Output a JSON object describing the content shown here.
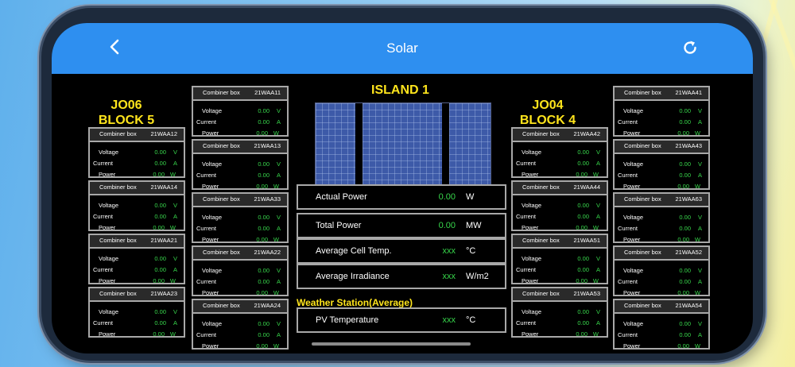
{
  "nav": {
    "title": "Solar",
    "back_icon": "chevron-left-icon",
    "refresh_icon": "refresh-icon"
  },
  "left_block": {
    "line1": "JO06",
    "line2": "BLOCK 5"
  },
  "right_block": {
    "line1": "JO04",
    "line2": "BLOCK 4"
  },
  "labels": {
    "header": "Combiner box",
    "voltage": "Voltage",
    "current": "Current",
    "power": "Power"
  },
  "combiner_columns": [
    {
      "boxes": [
        {
          "id": "21WAA12",
          "voltage": "0.00",
          "v_unit": "V",
          "current": "0.00",
          "c_unit": "A",
          "power": "0.00",
          "p_unit": "W"
        },
        {
          "id": "21WAA14",
          "voltage": "0.00",
          "v_unit": "V",
          "current": "0.00",
          "c_unit": "A",
          "power": "0.00",
          "p_unit": "W"
        },
        {
          "id": "21WAA21",
          "voltage": "0.00",
          "v_unit": "V",
          "current": "0.00",
          "c_unit": "A",
          "power": "0.00",
          "p_unit": "W"
        },
        {
          "id": "21WAA23",
          "voltage": "0.00",
          "v_unit": "V",
          "current": "0.00",
          "c_unit": "A",
          "power": "0.00",
          "p_unit": "W"
        }
      ]
    },
    {
      "boxes": [
        {
          "id": "21WAA11",
          "voltage": "0.00",
          "v_unit": "V",
          "current": "0.00",
          "c_unit": "A",
          "power": "0.00",
          "p_unit": "W"
        },
        {
          "id": "21WAA13",
          "voltage": "0.00",
          "v_unit": "V",
          "current": "0.00",
          "c_unit": "A",
          "power": "0.00",
          "p_unit": "W"
        },
        {
          "id": "21WAA33",
          "voltage": "0.00",
          "v_unit": "V",
          "current": "0.00",
          "c_unit": "A",
          "power": "0.00",
          "p_unit": "W"
        },
        {
          "id": "21WAA22",
          "voltage": "0.00",
          "v_unit": "V",
          "current": "0.00",
          "c_unit": "A",
          "power": "0.00",
          "p_unit": "W"
        },
        {
          "id": "21WAA24",
          "voltage": "0.00",
          "v_unit": "V",
          "current": "0.00",
          "c_unit": "A",
          "power": "0.00",
          "p_unit": "W"
        }
      ]
    },
    {
      "boxes": [
        {
          "id": "21WAA42",
          "voltage": "0.00",
          "v_unit": "V",
          "current": "0.00",
          "c_unit": "A",
          "power": "0.00",
          "p_unit": "W"
        },
        {
          "id": "21WAA44",
          "voltage": "0.00",
          "v_unit": "V",
          "current": "0.00",
          "c_unit": "A",
          "power": "0.00",
          "p_unit": "W"
        },
        {
          "id": "21WAA51",
          "voltage": "0.00",
          "v_unit": "V",
          "current": "0.00",
          "c_unit": "A",
          "power": "0.00",
          "p_unit": "W"
        },
        {
          "id": "21WAA53",
          "voltage": "0.00",
          "v_unit": "V",
          "current": "0.00",
          "c_unit": "A",
          "power": "0.00",
          "p_unit": "W"
        }
      ]
    },
    {
      "boxes": [
        {
          "id": "21WAA41",
          "voltage": "0.00",
          "v_unit": "V",
          "current": "0.00",
          "c_unit": "A",
          "power": "0.00",
          "p_unit": "W"
        },
        {
          "id": "21WAA43",
          "voltage": "0.00",
          "v_unit": "V",
          "current": "0.00",
          "c_unit": "A",
          "power": "0.00",
          "p_unit": "W"
        },
        {
          "id": "21WAA63",
          "voltage": "0.00",
          "v_unit": "V",
          "current": "0.00",
          "c_unit": "A",
          "power": "0.00",
          "p_unit": "W"
        },
        {
          "id": "21WAA52",
          "voltage": "0.00",
          "v_unit": "V",
          "current": "0.00",
          "c_unit": "A",
          "power": "0.00",
          "p_unit": "W"
        },
        {
          "id": "21WAA54",
          "voltage": "0.00",
          "v_unit": "V",
          "current": "0.00",
          "c_unit": "A",
          "power": "0.00",
          "p_unit": "W"
        }
      ]
    }
  ],
  "island": {
    "title": "ISLAND 1",
    "metrics": [
      {
        "label": "Actual Power",
        "value": "0.00",
        "unit": "W"
      },
      {
        "label": "Total Power",
        "value": "0.00",
        "unit": "MW"
      },
      {
        "label": "Average Cell Temp.",
        "value": "xxx",
        "unit": "°C"
      },
      {
        "label": "Average Irradiance",
        "value": "xxx",
        "unit": "W/m2"
      }
    ],
    "weather_title": "Weather Station(Average)",
    "weather_metrics": [
      {
        "label": "PV Temperature",
        "value": "xxx",
        "unit": "°C"
      }
    ]
  },
  "colors": {
    "nav": "#2e8ff0",
    "title_yellow": "#ffe51c",
    "value_green": "#37d64b"
  }
}
